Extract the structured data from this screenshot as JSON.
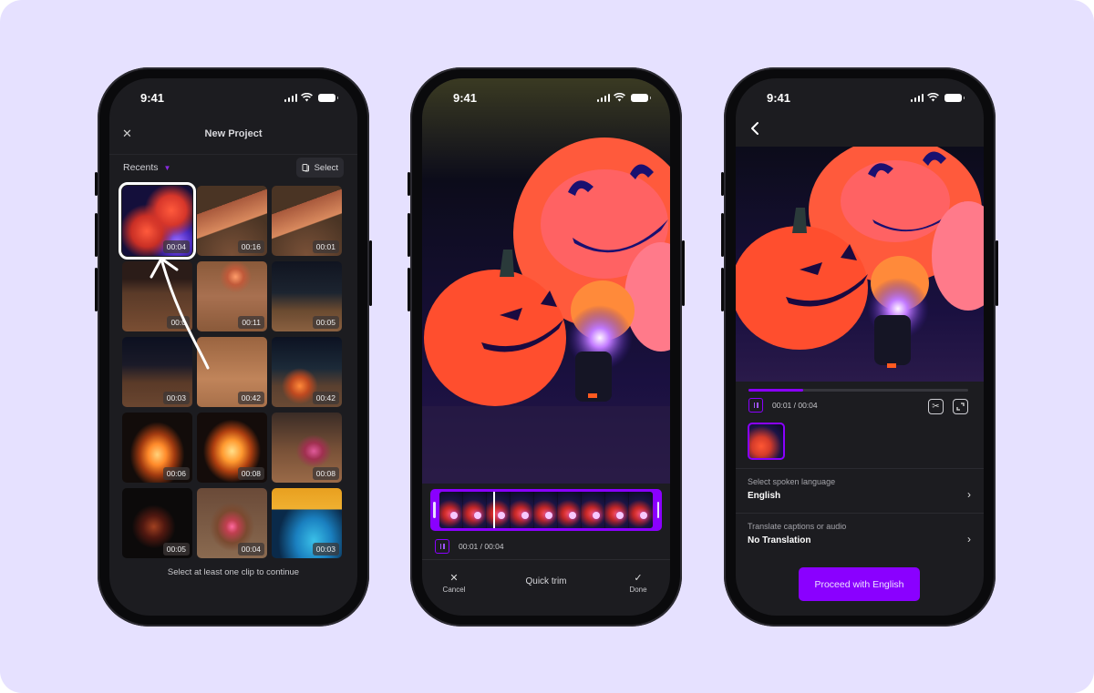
{
  "colors": {
    "accent": "#8a00ff",
    "background": "#e6e1ff",
    "screen": "#1c1c20"
  },
  "status_bar": {
    "time": "9:41"
  },
  "screen1": {
    "header_title": "New Project",
    "close_icon": "close-icon",
    "album_label": "Recents",
    "select_label": "Select",
    "clips": [
      {
        "duration": "00:04",
        "selected": true,
        "scene": "pumpkins"
      },
      {
        "duration": "00:16",
        "scene": "string-lights-canopy"
      },
      {
        "duration": "00:01",
        "scene": "string-lights-canopy"
      },
      {
        "duration": "00:0",
        "scene": "courtyard-chairs"
      },
      {
        "duration": "00:11",
        "scene": "fire-pit-chairs"
      },
      {
        "duration": "00:05",
        "scene": "string-lights-tents"
      },
      {
        "duration": "00:03",
        "scene": "night-string-lights"
      },
      {
        "duration": "00:42",
        "scene": "chairs-sand"
      },
      {
        "duration": "00:42",
        "scene": "campfire-people"
      },
      {
        "duration": "00:06",
        "scene": "bonfire"
      },
      {
        "duration": "00:08",
        "scene": "bonfire"
      },
      {
        "duration": "00:08",
        "scene": "fire-logs"
      },
      {
        "duration": "00:05",
        "scene": "dark-fire"
      },
      {
        "duration": "00:04",
        "scene": "fire-pit"
      },
      {
        "duration": "00:03",
        "scene": "bunting-flags"
      }
    ],
    "footer_hint": "Select at least one clip to continue"
  },
  "screen2": {
    "timecode": "00:01 / 00:04",
    "playhead_fraction": 0.25,
    "cancel_label": "Cancel",
    "title": "Quick trim",
    "done_label": "Done"
  },
  "screen3": {
    "back_icon": "chevron-left-icon",
    "timecode": "00:01 / 00:04",
    "progress_fraction": 0.25,
    "settings": [
      {
        "label": "Select spoken language",
        "value": "English"
      },
      {
        "label": "Translate captions or audio",
        "value": "No Translation"
      }
    ],
    "proceed_label": "Proceed with English"
  }
}
